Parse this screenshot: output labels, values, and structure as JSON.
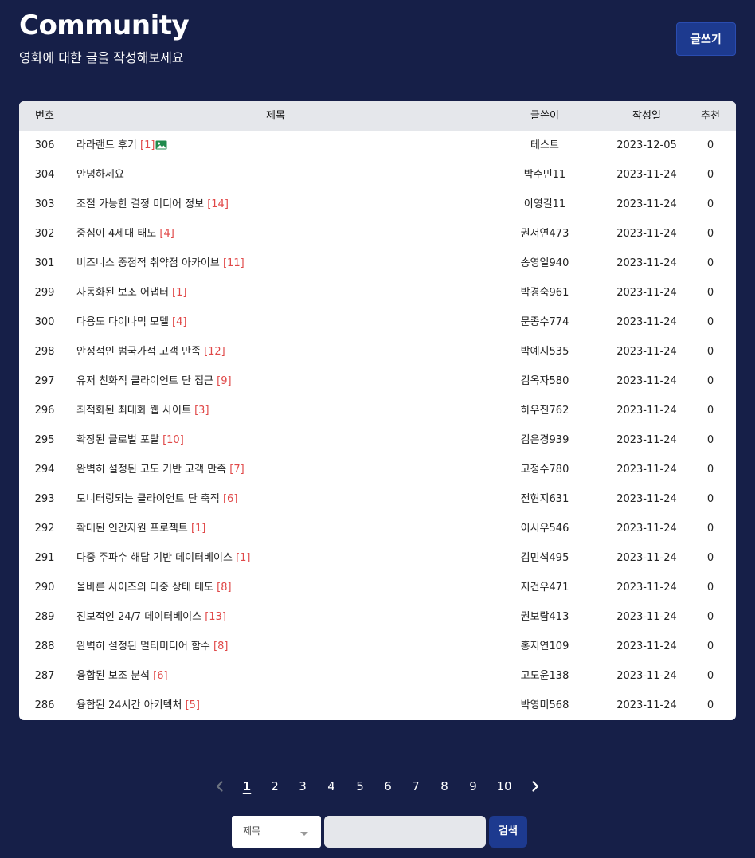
{
  "header": {
    "title": "Community",
    "subtitle": "영화에 대한 글을 작성해보세요",
    "write_button": "글쓰기"
  },
  "table": {
    "columns": {
      "no": "번호",
      "title": "제목",
      "writer": "글쓴이",
      "date": "작성일",
      "recommend": "추천"
    },
    "rows": [
      {
        "no": "306",
        "title": "라라랜드 후기",
        "comments": "[1]",
        "has_image": true,
        "writer": "테스트",
        "date": "2023-12-05",
        "recommend": "0"
      },
      {
        "no": "304",
        "title": "안녕하세요",
        "comments": "",
        "has_image": false,
        "writer": "박수민11",
        "date": "2023-11-24",
        "recommend": "0"
      },
      {
        "no": "303",
        "title": "조절 가능한 결정 미디어 정보",
        "comments": "[14]",
        "has_image": false,
        "writer": "이영길11",
        "date": "2023-11-24",
        "recommend": "0"
      },
      {
        "no": "302",
        "title": "중심이 4세대 태도",
        "comments": "[4]",
        "has_image": false,
        "writer": "권서연473",
        "date": "2023-11-24",
        "recommend": "0"
      },
      {
        "no": "301",
        "title": "비즈니스 중점적 취약점 아카이브",
        "comments": "[11]",
        "has_image": false,
        "writer": "송영일940",
        "date": "2023-11-24",
        "recommend": "0"
      },
      {
        "no": "299",
        "title": "자동화된 보조 어댑터",
        "comments": "[1]",
        "has_image": false,
        "writer": "박경숙961",
        "date": "2023-11-24",
        "recommend": "0"
      },
      {
        "no": "300",
        "title": "다용도 다이나믹 모델",
        "comments": "[4]",
        "has_image": false,
        "writer": "문종수774",
        "date": "2023-11-24",
        "recommend": "0"
      },
      {
        "no": "298",
        "title": "안정적인 범국가적 고객 만족",
        "comments": "[12]",
        "has_image": false,
        "writer": "박예지535",
        "date": "2023-11-24",
        "recommend": "0"
      },
      {
        "no": "297",
        "title": "유저 친화적 클라이언트 단 접근",
        "comments": "[9]",
        "has_image": false,
        "writer": "김옥자580",
        "date": "2023-11-24",
        "recommend": "0"
      },
      {
        "no": "296",
        "title": "최적화된 최대화 웹 사이트",
        "comments": "[3]",
        "has_image": false,
        "writer": "하우진762",
        "date": "2023-11-24",
        "recommend": "0"
      },
      {
        "no": "295",
        "title": "확장된 글로벌 포탈",
        "comments": "[10]",
        "has_image": false,
        "writer": "김은경939",
        "date": "2023-11-24",
        "recommend": "0"
      },
      {
        "no": "294",
        "title": "완벽히 설정된 고도 기반 고객 만족",
        "comments": "[7]",
        "has_image": false,
        "writer": "고정수780",
        "date": "2023-11-24",
        "recommend": "0"
      },
      {
        "no": "293",
        "title": "모니터링되는 클라이언트 단 축적",
        "comments": "[6]",
        "has_image": false,
        "writer": "전현지631",
        "date": "2023-11-24",
        "recommend": "0"
      },
      {
        "no": "292",
        "title": "확대된 인간자원 프로젝트",
        "comments": "[1]",
        "has_image": false,
        "writer": "이시우546",
        "date": "2023-11-24",
        "recommend": "0"
      },
      {
        "no": "291",
        "title": "다중 주파수 해답 기반 데이터베이스",
        "comments": "[1]",
        "has_image": false,
        "writer": "김민석495",
        "date": "2023-11-24",
        "recommend": "0"
      },
      {
        "no": "290",
        "title": "올바른 사이즈의 다중 상태 태도",
        "comments": "[8]",
        "has_image": false,
        "writer": "지건우471",
        "date": "2023-11-24",
        "recommend": "0"
      },
      {
        "no": "289",
        "title": "진보적인 24/7 데이터베이스",
        "comments": "[13]",
        "has_image": false,
        "writer": "권보람413",
        "date": "2023-11-24",
        "recommend": "0"
      },
      {
        "no": "288",
        "title": "완벽히 설정된 멀티미디어 함수",
        "comments": "[8]",
        "has_image": false,
        "writer": "홍지연109",
        "date": "2023-11-24",
        "recommend": "0"
      },
      {
        "no": "287",
        "title": "융합된 보조 분석",
        "comments": "[6]",
        "has_image": false,
        "writer": "고도윤138",
        "date": "2023-11-24",
        "recommend": "0"
      },
      {
        "no": "286",
        "title": "융합된 24시간 아키텍처",
        "comments": "[5]",
        "has_image": false,
        "writer": "박영미568",
        "date": "2023-11-24",
        "recommend": "0"
      }
    ]
  },
  "pagination": {
    "prev_icon": "chevron-left-icon",
    "next_icon": "chevron-right-icon",
    "current": 1,
    "pages": [
      "1",
      "2",
      "3",
      "4",
      "5",
      "6",
      "7",
      "8",
      "9",
      "10"
    ]
  },
  "search": {
    "select_value": "제목",
    "input_value": "",
    "button_label": "검색"
  },
  "colors": {
    "background": "#161f48",
    "accent": "#1d3a8f",
    "comment": "#e04848",
    "header_row": "#e5e7eb"
  }
}
